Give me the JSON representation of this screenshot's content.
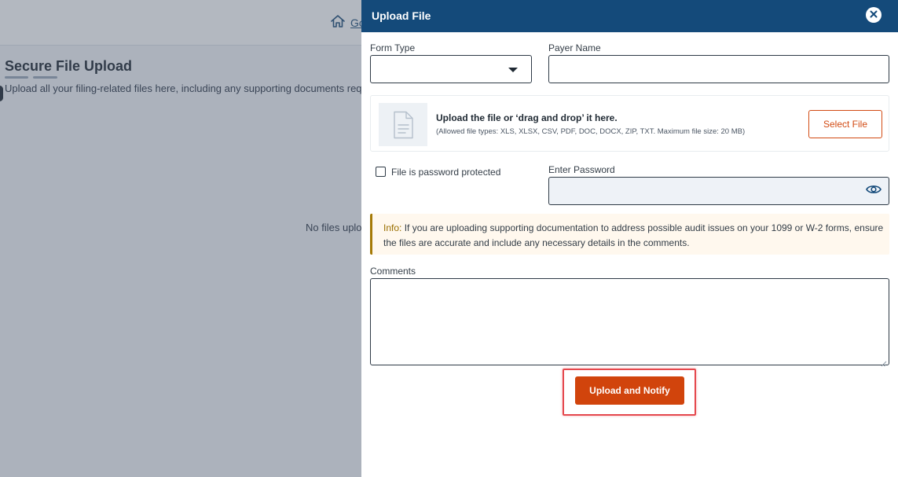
{
  "background": {
    "home_link": "Go",
    "page_title": "Secure File Upload",
    "description": "Upload all your filing-related files here, including any supporting documents requir",
    "empty_state": "No files uploa"
  },
  "drawer": {
    "title": "Upload File",
    "close_icon": "close-icon",
    "form_type_label": "Form Type",
    "form_type_value": "",
    "payer_name_label": "Payer Name",
    "payer_name_value": "",
    "upload": {
      "title": "Upload the file or ‘drag and drop’ it here.",
      "subtitle": "(Allowed file types: XLS, XLSX, CSV, PDF, DOC, DOCX, ZIP, TXT. Maximum file size: 20 MB)",
      "select_button": "Select File",
      "icon": "document-icon"
    },
    "password_protected_label": "File is password protected",
    "password_protected_checked": false,
    "password_label": "Enter Password",
    "password_value": "",
    "info_prefix": "Info:",
    "info_text": " If you are uploading supporting documentation to address possible audit issues on your 1099 or W-2 forms, ensure the files are accurate and include any necessary details in the comments.",
    "comments_label": "Comments",
    "comments_value": "",
    "submit_button": "Upload and Notify"
  },
  "colors": {
    "header": "#144a7a",
    "primary": "#d1440c",
    "highlight": "#e5484d",
    "info_accent": "#a57a07"
  }
}
